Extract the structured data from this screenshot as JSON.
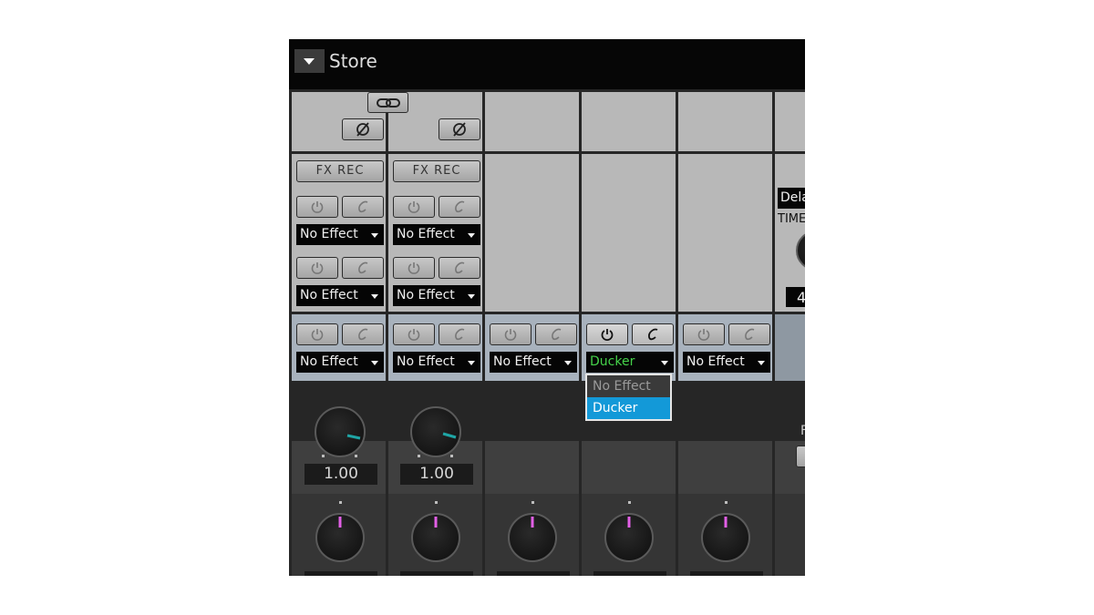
{
  "header": {
    "title": "Store"
  },
  "fx_rec_label": "FX REC",
  "insert_slots": {
    "row1": [
      "No Effect",
      "No Effect"
    ],
    "row2": [
      "No Effect",
      "No Effect"
    ],
    "row3": [
      "No Effect",
      "No Effect",
      "No Effect",
      "Ducker",
      "No Effect"
    ]
  },
  "dropdown": {
    "options": [
      "No Effect",
      "Ducker"
    ],
    "selected": "Ducker"
  },
  "send_values": [
    "1.00",
    "1.00"
  ],
  "effect_panel": {
    "name_partial": "Dela",
    "param_partial": "TIME",
    "value_partial": "4"
  },
  "right_panel_partial": "F",
  "colors": {
    "ducker_text": "#45d24a",
    "selected_option": "#1399d8",
    "knob_teal": "#1fa5a5",
    "knob_pink": "#e25fe6"
  },
  "icons": [
    "menu-triangle-icon",
    "link-icon",
    "phase-invert-icon",
    "power-icon",
    "edit-icon",
    "chevron-down-icon"
  ]
}
